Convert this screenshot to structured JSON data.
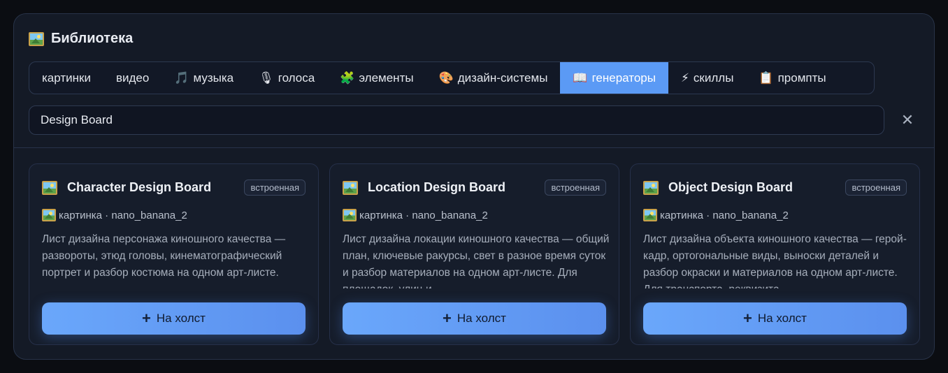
{
  "header": {
    "title": "Библиотека",
    "title_icon": "framed-picture-icon"
  },
  "tabs": [
    {
      "label": "картинки",
      "icon": "",
      "active": false
    },
    {
      "label": "видео",
      "icon": "",
      "active": false
    },
    {
      "label": "музыка",
      "icon": "🎵",
      "active": false
    },
    {
      "label": "голоса",
      "icon": "🎙",
      "active": false
    },
    {
      "label": "элементы",
      "icon": "🧩",
      "active": false
    },
    {
      "label": "дизайн-системы",
      "icon": "🎨",
      "active": false
    },
    {
      "label": "генераторы",
      "icon": "📖",
      "active": true
    },
    {
      "label": "скиллы",
      "icon": "⚡",
      "active": false
    },
    {
      "label": "промпты",
      "icon": "📋",
      "active": false
    }
  ],
  "search": {
    "value": "Design Board",
    "placeholder": ""
  },
  "clear_glyph": "✕",
  "cards": [
    {
      "title": "Character Design Board",
      "badge": "встроенная",
      "meta": "картинка · nano_banana_2",
      "description": "Лист дизайна персонажа киношного качества — развороты, этюд головы, кинематографический портрет и разбор костюма на одном арт-листе.",
      "button": "На холст"
    },
    {
      "title": "Location Design Board",
      "badge": "встроенная",
      "meta": "картинка · nano_banana_2",
      "description": "Лист дизайна локации киношного качества — общий план, ключевые ракурсы, свет в разное время суток и разбор материалов на одном арт-листе. Для площадок, улиц и",
      "button": "На холст"
    },
    {
      "title": "Object Design Board",
      "badge": "встроенная",
      "meta": "картинка · nano_banana_2",
      "description": "Лист дизайна объекта киношного качества — герой-кадр, ортогональные виды, выноски деталей и разбор окраски и материалов на одном арт-листе. Для транспорта, реквизита",
      "button": "На холст"
    }
  ],
  "colors": {
    "accent": "#5b9af5",
    "panel": "#141a26",
    "background": "#0b0d12"
  }
}
